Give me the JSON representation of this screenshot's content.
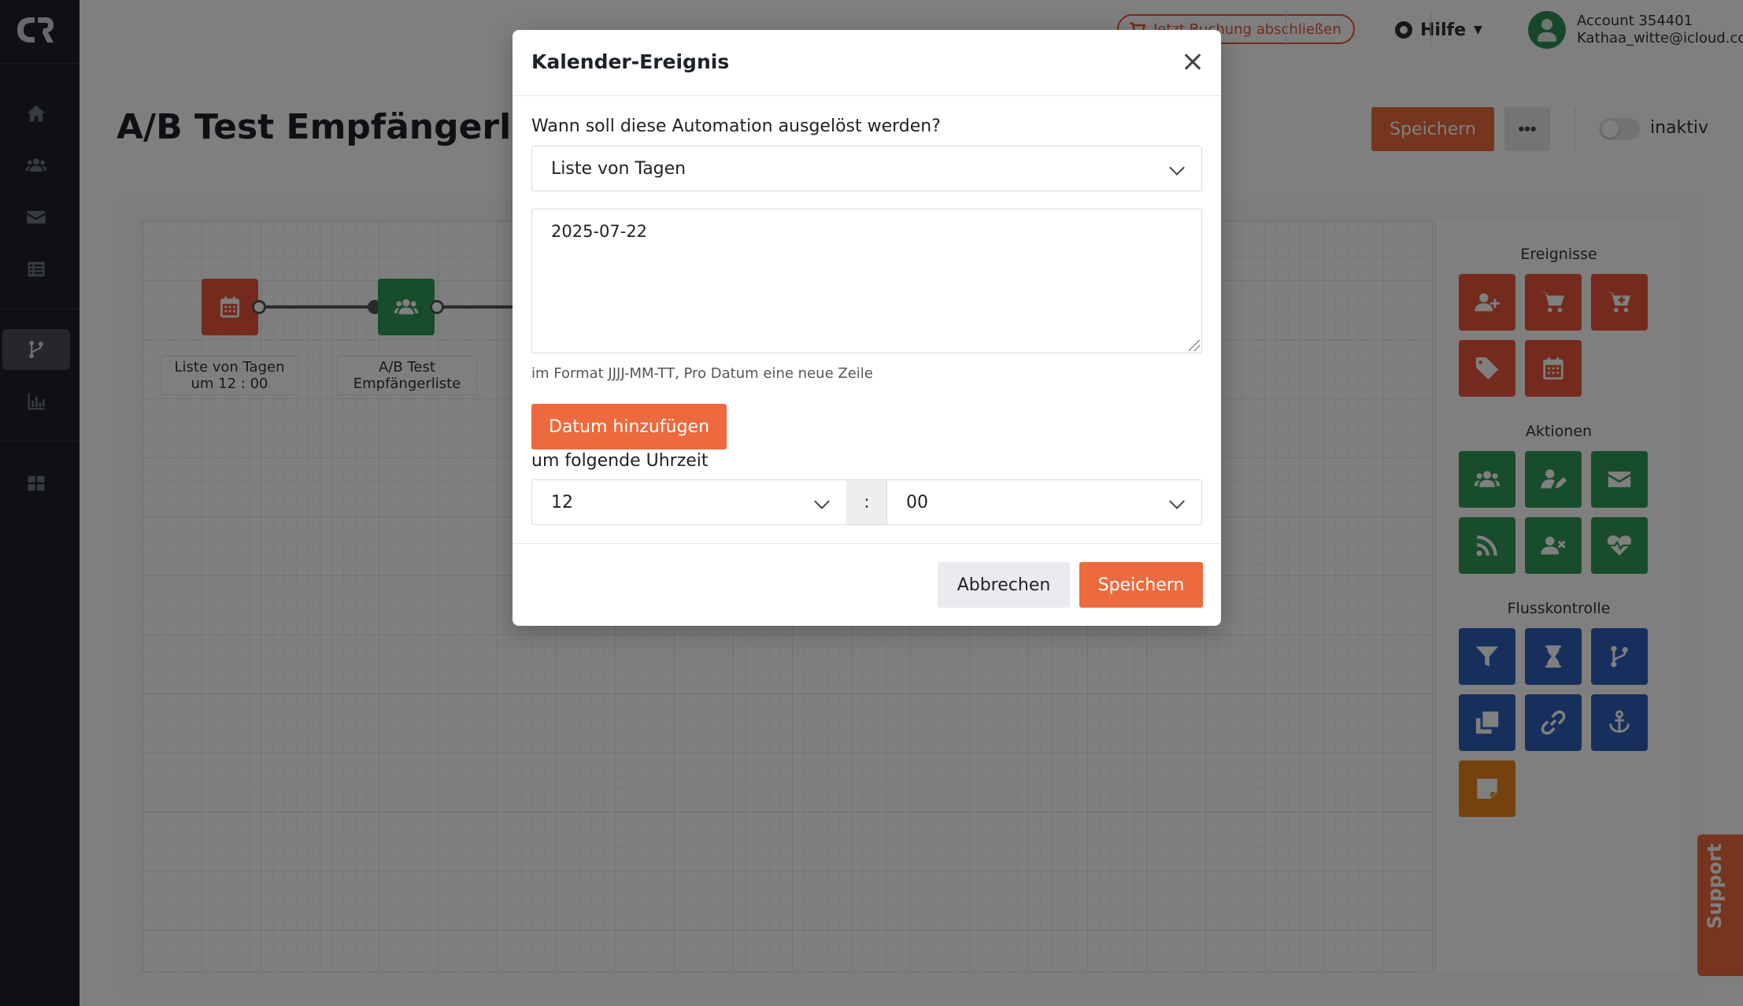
{
  "topbar": {
    "promo_label": "Jetzt Buchung abschließen",
    "help_label": "Hilfe",
    "account_name": "Account 354401",
    "account_email": "Kathaa_witte@icloud.co..."
  },
  "page": {
    "title": "A/B Test Empfängerliste",
    "save_label": "Speichern",
    "more_label": "•••",
    "status_label": "inaktiv"
  },
  "flow": {
    "nodes": [
      {
        "label": "Liste von Tagen\num 12 : 00",
        "icon": "calendar-icon",
        "color": "#e8553a"
      },
      {
        "label": "A/B Test\nEmpfängerliste",
        "icon": "users-icon",
        "color": "#2f9a55"
      }
    ]
  },
  "palette": {
    "events_title": "Ereignisse",
    "actions_title": "Aktionen",
    "flow_title": "Flusskontrolle",
    "events": [
      "user-plus-icon",
      "cart-icon",
      "cart-plus-icon",
      "tag-icon",
      "calendar-icon"
    ],
    "actions": [
      "users-icon",
      "user-edit-icon",
      "mail-icon",
      "rss-icon",
      "user-remove-icon",
      "heartbeat-icon"
    ],
    "flow": [
      "filter-icon",
      "hourglass-icon",
      "branch-icon",
      "copy-icon",
      "link-icon",
      "anchor-icon",
      "note-icon"
    ]
  },
  "support_label": "Support",
  "modal": {
    "title": "Kalender-Ereignis",
    "question": "Wann soll diese Automation ausgelöst werden?",
    "trigger_value": "Liste von Tagen",
    "dates_value": "2025-07-22",
    "hint": "im Format JJJJ-MM-TT, Pro Datum eine neue Zeile",
    "add_date_label": "Datum hinzufügen",
    "time_label": "um folgende Uhrzeit",
    "hour_value": "12",
    "colon": ":",
    "minute_value": "00",
    "cancel_label": "Abbrechen",
    "save_label": "Speichern"
  },
  "colors": {
    "accent": "#ec6a3d",
    "sidebar": "#1d2128",
    "events": "#e8553a",
    "actions": "#2f9a55",
    "flow_control": "#2f5fb8",
    "note": "#e8841f"
  }
}
